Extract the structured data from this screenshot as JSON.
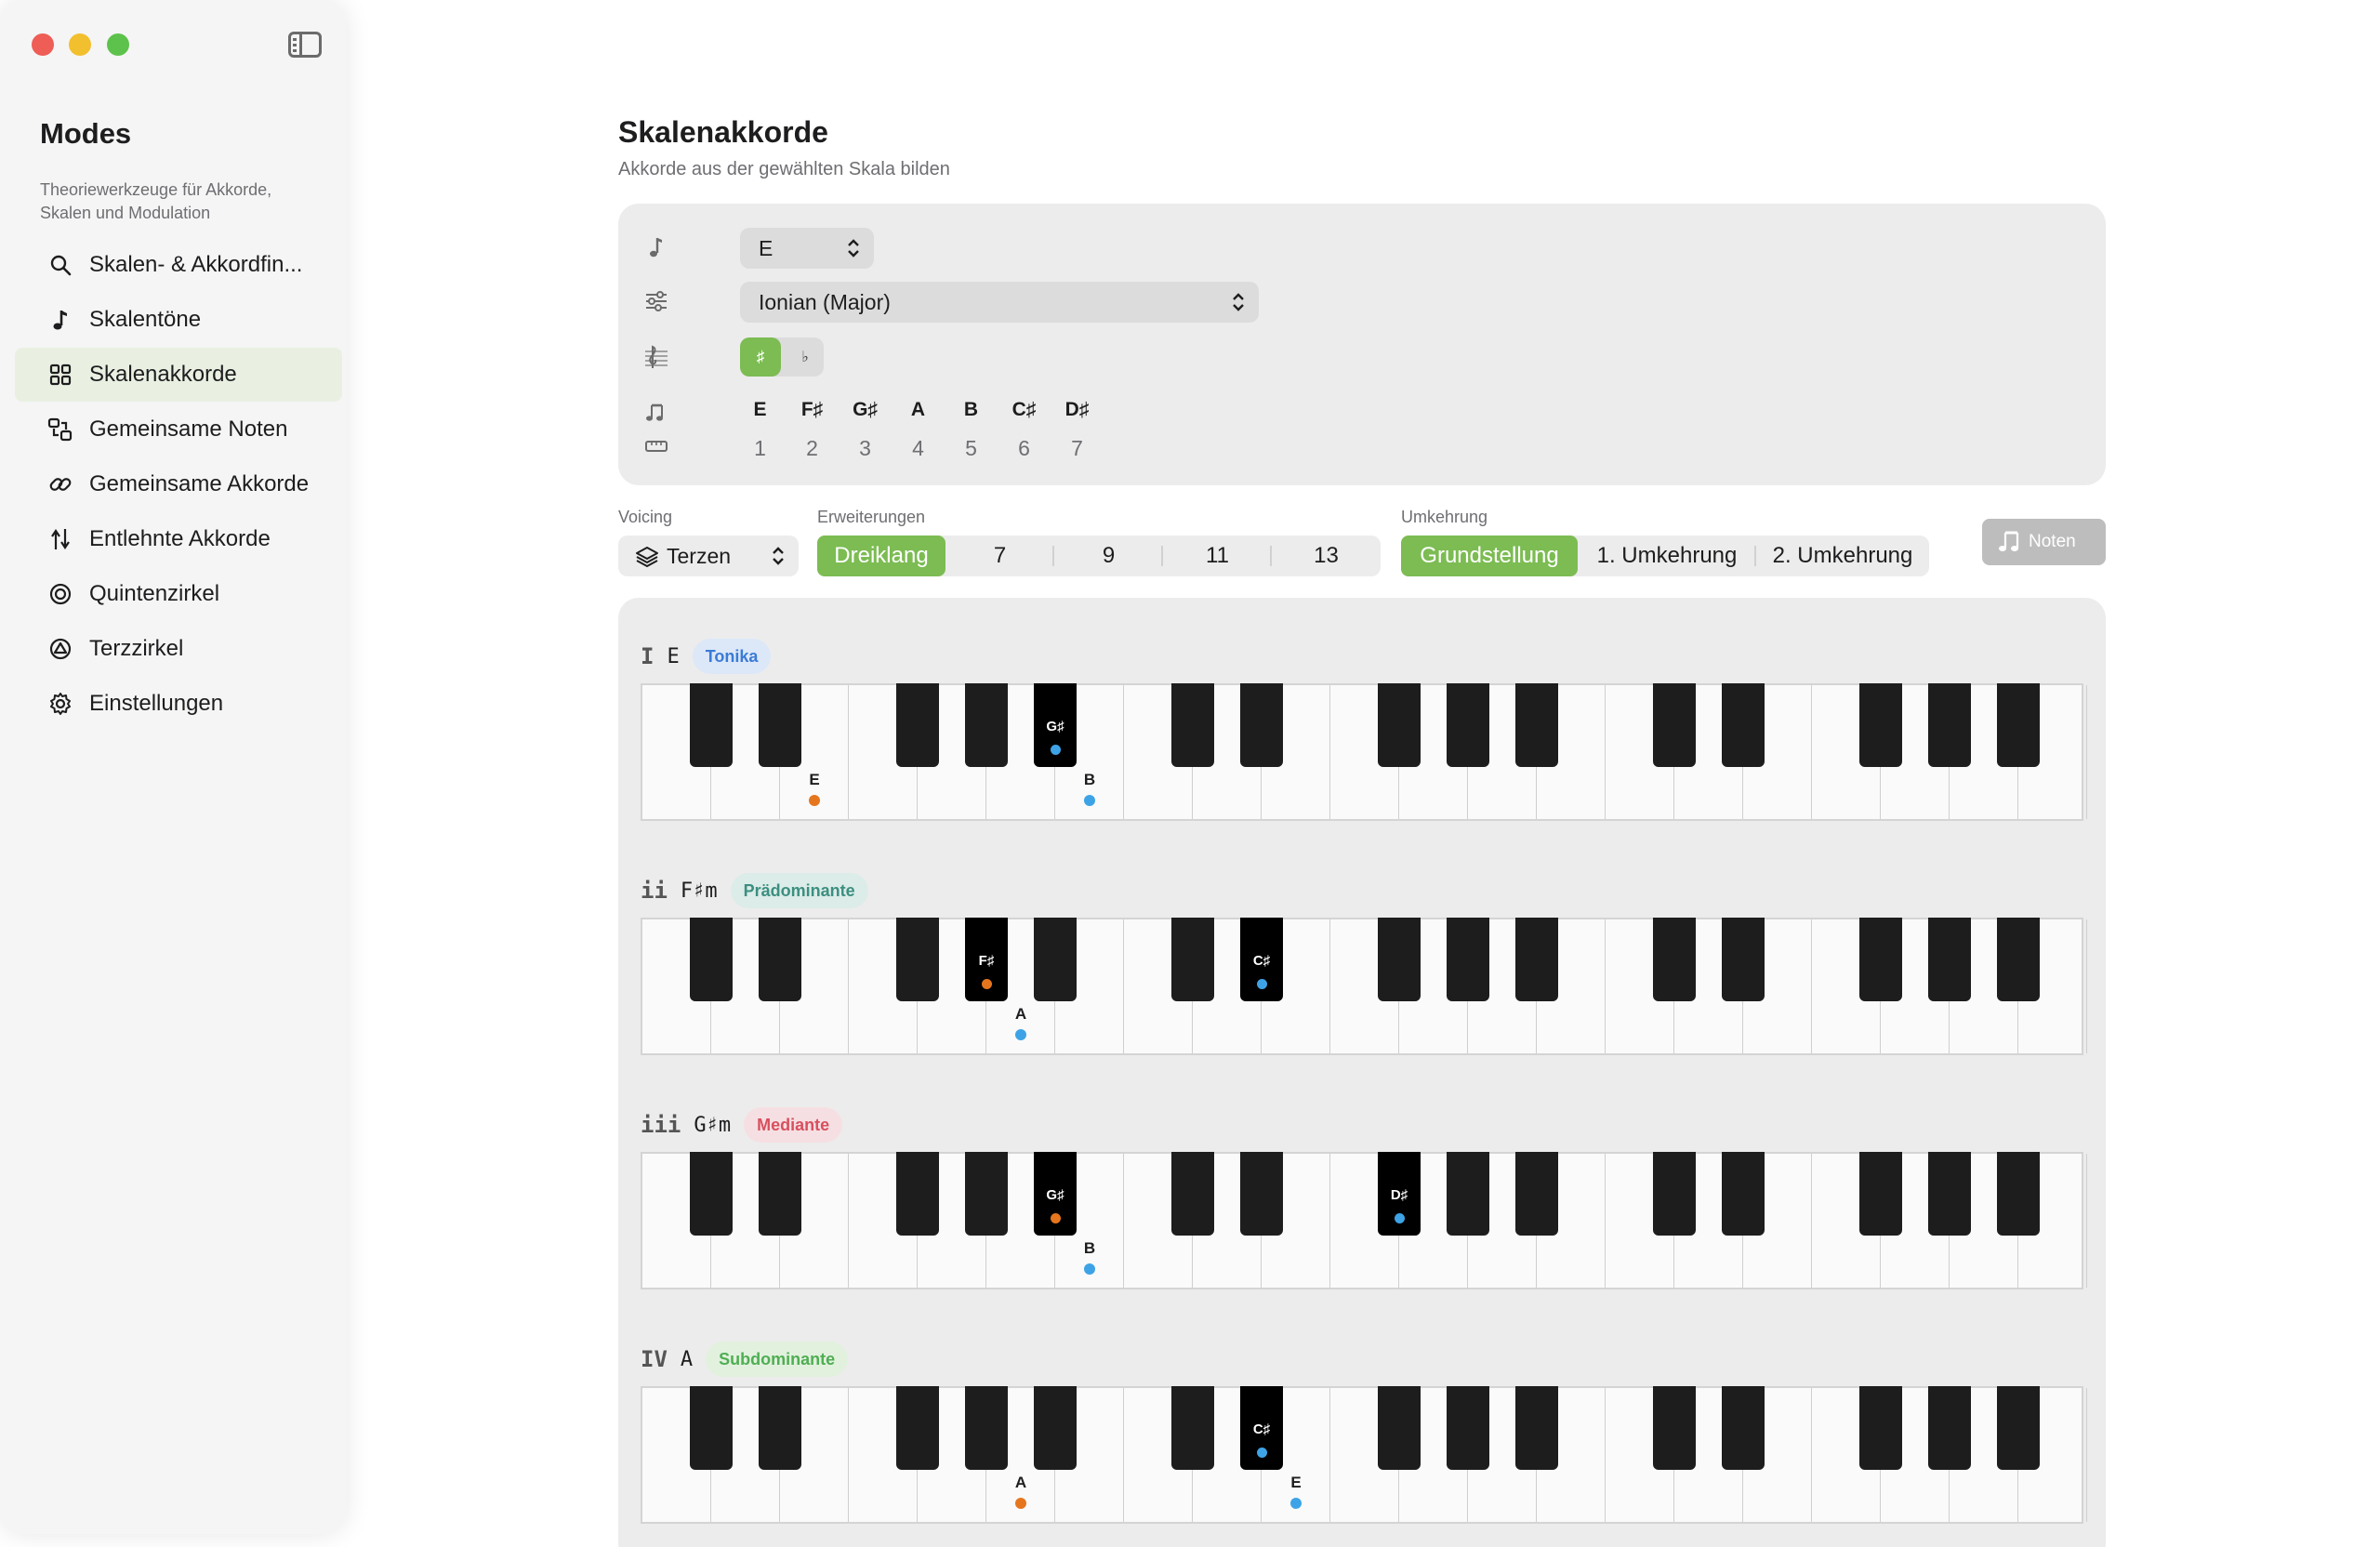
{
  "sidebar": {
    "title": "Modes",
    "subtitle": "Theoriewerkzeuge für Akkorde, Skalen und Modulation",
    "items": [
      {
        "label": "Skalen- & Akkordfin...",
        "icon": "search-icon"
      },
      {
        "label": "Skalentöne",
        "icon": "music-note-icon"
      },
      {
        "label": "Skalenakkorde",
        "icon": "grid-icon",
        "active": true
      },
      {
        "label": "Gemeinsame Noten",
        "icon": "shapes-swap-icon"
      },
      {
        "label": "Gemeinsame Akkorde",
        "icon": "link-icon"
      },
      {
        "label": "Entlehnte Akkorde",
        "icon": "branch-icon"
      },
      {
        "label": "Quintenzirkel",
        "icon": "target-circle-icon"
      },
      {
        "label": "Terzzirkel",
        "icon": "triangle-circle-icon"
      },
      {
        "label": "Einstellungen",
        "icon": "gear-icon"
      }
    ]
  },
  "header": {
    "title": "Skalenakkorde",
    "subtitle": "Akkorde aus der gewählten Skala bilden"
  },
  "config": {
    "root_note": "E",
    "mode": "Ionian (Major)",
    "accidentals": {
      "sharp": "♯",
      "flat": "♭",
      "selected": "sharp"
    },
    "scale_notes": [
      "E",
      "F♯",
      "G♯",
      "A",
      "B",
      "C♯",
      "D♯"
    ],
    "scale_degrees": [
      "1",
      "2",
      "3",
      "4",
      "5",
      "6",
      "7"
    ]
  },
  "controls": {
    "voicing_label": "Voicing",
    "voicing_value": "Terzen",
    "extensions_label": "Erweiterungen",
    "extensions": [
      "Dreiklang",
      "7",
      "9",
      "11",
      "13"
    ],
    "extension_selected": "Dreiklang",
    "inversion_label": "Umkehrung",
    "inversions": [
      "Grundstellung",
      "1. Umkehrung",
      "2. Umkehrung"
    ],
    "inversion_selected": "Grundstellung",
    "notes_button": "Noten"
  },
  "colors": {
    "accent": "#7cbc53",
    "root_dot": "#e5761e",
    "tone_dot": "#3ea3e6",
    "tonika_bg": "#dce8f8",
    "tonika_fg": "#3b7bd6",
    "praedominante_bg": "#dcece8",
    "praedominante_fg": "#3c8f80",
    "mediante_bg": "#f6dfe2",
    "mediante_fg": "#d8505f",
    "subdominante_bg": "#e2f1de",
    "subdominante_fg": "#4fae53"
  },
  "chords": [
    {
      "roman": "I",
      "name": "E",
      "function": "Tonika",
      "style": "tonika",
      "notes": [
        {
          "key": "w2",
          "label": "E",
          "role": "root"
        },
        {
          "key": "b4",
          "label": "G♯",
          "role": "tone"
        },
        {
          "key": "w6",
          "label": "B",
          "role": "tone"
        }
      ]
    },
    {
      "roman": "ii",
      "name": "F♯m",
      "function": "Prädominante",
      "style": "praedominante",
      "notes": [
        {
          "key": "b3",
          "label": "F♯",
          "role": "root"
        },
        {
          "key": "w5",
          "label": "A",
          "role": "tone"
        },
        {
          "key": "b6",
          "label": "C♯",
          "role": "tone"
        }
      ]
    },
    {
      "roman": "iii",
      "name": "G♯m",
      "function": "Mediante",
      "style": "mediante",
      "notes": [
        {
          "key": "b4",
          "label": "G♯",
          "role": "root"
        },
        {
          "key": "w6",
          "label": "B",
          "role": "tone"
        },
        {
          "key": "b7",
          "label": "D♯",
          "role": "tone"
        }
      ]
    },
    {
      "roman": "IV",
      "name": "A",
      "function": "Subdominante",
      "style": "subdominante",
      "notes": [
        {
          "key": "w5",
          "label": "A",
          "role": "root"
        },
        {
          "key": "b6",
          "label": "C♯",
          "role": "tone"
        },
        {
          "key": "w9",
          "label": "E",
          "role": "tone"
        }
      ]
    }
  ]
}
